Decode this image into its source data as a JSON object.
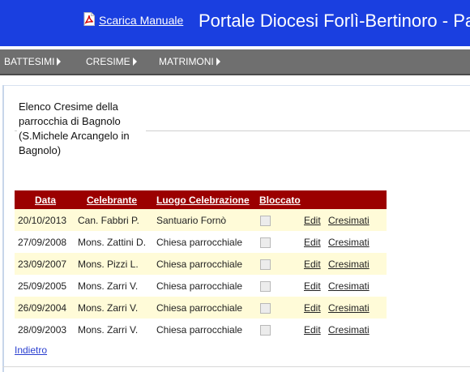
{
  "header": {
    "manual_label": "Scarica Manuale",
    "title": "Portale Diocesi Forlì-Bertinoro - Parr",
    "background_color": "#1a3fe0",
    "pdf_icon": "pdf-document-icon"
  },
  "menu": {
    "items": [
      {
        "label": "BATTESIMI",
        "icon": "chevron-right-icon"
      },
      {
        "label": "CRESIME",
        "icon": "chevron-right-icon"
      },
      {
        "label": "MATRIMONI",
        "icon": "chevron-right-icon"
      }
    ],
    "background_color": "#6f6f6f"
  },
  "page": {
    "heading": "Elenco Cresime della parrocchia di Bagnolo (S.Michele Arcangelo in Bagnolo)"
  },
  "table": {
    "header_color": "#9b0000",
    "columns": [
      "Data",
      "Celebrante",
      "Luogo Celebrazione",
      "Bloccato"
    ],
    "rows": [
      {
        "data": "20/10/2013",
        "celebrante": "Can. Fabbri P.",
        "luogo": "Santuario Fornò",
        "bloccato": false,
        "edit": "Edit",
        "cresimati": "Cresimati"
      },
      {
        "data": "27/09/2008",
        "celebrante": "Mons. Zattini D.",
        "luogo": "Chiesa parrocchiale",
        "bloccato": false,
        "edit": "Edit",
        "cresimati": "Cresimati"
      },
      {
        "data": "23/09/2007",
        "celebrante": "Mons. Pizzi L.",
        "luogo": "Chiesa parrocchiale",
        "bloccato": false,
        "edit": "Edit",
        "cresimati": "Cresimati"
      },
      {
        "data": "25/09/2005",
        "celebrante": "Mons. Zarri V.",
        "luogo": "Chiesa parrocchiale",
        "bloccato": false,
        "edit": "Edit",
        "cresimati": "Cresimati"
      },
      {
        "data": "26/09/2004",
        "celebrante": "Mons. Zarri V.",
        "luogo": "Chiesa parrocchiale",
        "bloccato": false,
        "edit": "Edit",
        "cresimati": "Cresimati"
      },
      {
        "data": "28/09/2003",
        "celebrante": "Mons. Zarri V.",
        "luogo": "Chiesa parrocchiale",
        "bloccato": false,
        "edit": "Edit",
        "cresimati": "Cresimati"
      }
    ]
  },
  "footer": {
    "back_label": "Indietro"
  }
}
